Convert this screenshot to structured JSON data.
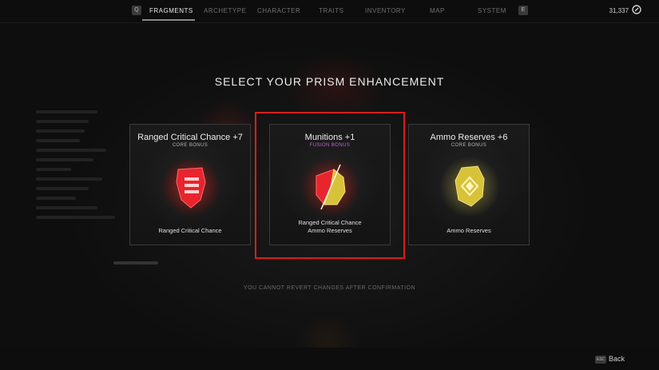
{
  "nav": {
    "prev_key": "Q",
    "next_key": "E",
    "tabs": [
      "FRAGMENTS",
      "ARCHETYPE",
      "CHARACTER",
      "TRAITS",
      "INVENTORY",
      "MAP",
      "SYSTEM"
    ],
    "active_tab": "FRAGMENTS",
    "currency": "31,337",
    "currency_icon": "scrap-coin-icon"
  },
  "title": "SELECT YOUR PRISM ENHANCEMENT",
  "cards": [
    {
      "title": "Ranged Critical Chance +7",
      "subtitle": "CORE BONUS",
      "gem": "red-prism-gem-icon",
      "footer": [
        "Ranged Critical Chance"
      ]
    },
    {
      "title": "Munitions +1",
      "subtitle": "FUSION BONUS",
      "gem": "red-yellow-fusion-gem-icon",
      "footer": [
        "Ranged Critical Chance",
        "Ammo Reserves"
      ]
    },
    {
      "title": "Ammo Reserves +6",
      "subtitle": "CORE BONUS",
      "gem": "yellow-prism-gem-icon",
      "footer": [
        "Ammo Reserves"
      ]
    }
  ],
  "selected_card": "Munitions +1",
  "warning": "YOU CANNOT REVERT CHANGES AFTER CONFIRMATION",
  "footer": {
    "back_key": "ESC",
    "back_label": "Back"
  },
  "colors": {
    "selection": "#d81e1e",
    "fusion": "#c462d6",
    "red_gem": "#e8242c",
    "yellow_gem": "#d8c23a"
  }
}
